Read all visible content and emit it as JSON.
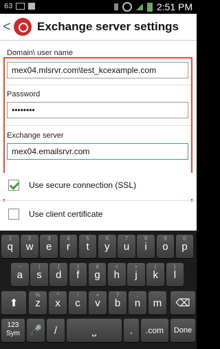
{
  "status_bar": {
    "left_text": "63",
    "time": "2:51 PM"
  },
  "action_bar": {
    "back": "<",
    "title": "Exchange server settings"
  },
  "form": {
    "domain_label": "Domain\\ user name",
    "domain_value": "mex04.mlsrvr.com\\test_kcexample.com",
    "password_label": "Password",
    "password_value": "••••••••",
    "server_label": "Exchange server",
    "server_value": "mex04.emailsrvr.com"
  },
  "options": {
    "ssl_label": "Use secure connection (SSL)",
    "ssl_checked": true,
    "cert_label": "Use client certificate",
    "cert_checked": false
  },
  "keyboard": {
    "row1": [
      {
        "main": "q",
        "sub": "1"
      },
      {
        "main": "w",
        "sub": "2"
      },
      {
        "main": "e",
        "sub": "3"
      },
      {
        "main": "r",
        "sub": "4"
      },
      {
        "main": "t",
        "sub": "5"
      },
      {
        "main": "y",
        "sub": "6"
      },
      {
        "main": "u",
        "sub": "7"
      },
      {
        "main": "i",
        "sub": "8"
      },
      {
        "main": "o",
        "sub": "9"
      },
      {
        "main": "p",
        "sub": "0"
      }
    ],
    "row2": [
      {
        "main": "a",
        "sub": "~"
      },
      {
        "main": "s",
        "sub": "|"
      },
      {
        "main": "d",
        "sub": "{"
      },
      {
        "main": "f",
        "sub": "}"
      },
      {
        "main": "g",
        "sub": "#"
      },
      {
        "main": "h",
        "sub": "<"
      },
      {
        "main": "j",
        "sub": ">"
      },
      {
        "main": "k",
        "sub": "("
      },
      {
        "main": "l",
        "sub": ")"
      }
    ],
    "row3": [
      {
        "main": "z",
        "sub": "%"
      },
      {
        "main": "x",
        "sub": "^"
      },
      {
        "main": "c",
        "sub": "!"
      },
      {
        "main": "v",
        "sub": "="
      },
      {
        "main": "b",
        "sub": "?"
      },
      {
        "main": "n",
        "sub": ";"
      },
      {
        "main": "m",
        "sub": ":"
      }
    ],
    "shift": "⬆",
    "backspace": "⌫",
    "sym_line1": "123",
    "sym_line2": "Sym",
    "mic": "🎤",
    "slash": "/",
    "space": "⎵",
    "dot": ".",
    "com": ".com",
    "done": "Done"
  }
}
